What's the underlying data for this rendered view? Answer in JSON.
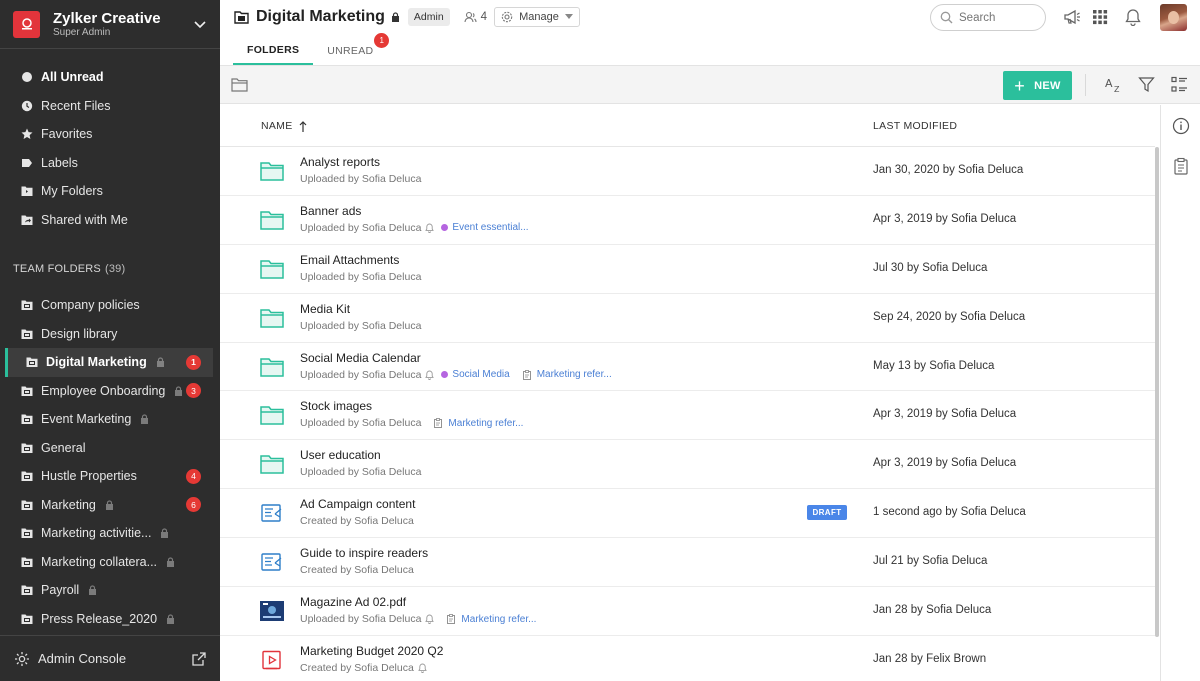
{
  "org": {
    "name": "Zylker Creative",
    "role": "Super Admin"
  },
  "nav": [
    {
      "label": "All Unread",
      "icon": "circle-dot-icon",
      "bold": true
    },
    {
      "label": "Recent Files",
      "icon": "clock-icon"
    },
    {
      "label": "Favorites",
      "icon": "star-icon"
    },
    {
      "label": "Labels",
      "icon": "label-icon"
    },
    {
      "label": "My Folders",
      "icon": "folder-icon"
    },
    {
      "label": "Shared with Me",
      "icon": "shared-folder-icon"
    }
  ],
  "team_folders": {
    "title": "TEAM FOLDERS",
    "count": "(39)"
  },
  "team": [
    {
      "label": "Company policies"
    },
    {
      "label": "Design library"
    },
    {
      "label": "Digital Marketing",
      "lock": true,
      "badge": "1",
      "active": true
    },
    {
      "label": "Employee Onboarding",
      "lock": true,
      "badge": "3"
    },
    {
      "label": "Event Marketing",
      "lock": true
    },
    {
      "label": "General"
    },
    {
      "label": "Hustle Properties",
      "badge": "4"
    },
    {
      "label": "Marketing",
      "lock": true,
      "badge": "6"
    },
    {
      "label": "Marketing activitie...",
      "lock": true
    },
    {
      "label": "Marketing collatera...",
      "lock": true
    },
    {
      "label": "Payroll",
      "lock": true
    },
    {
      "label": "Press Release_2020",
      "lock": true
    }
  ],
  "admin_console": "Admin Console",
  "header": {
    "title": "Digital Marketing",
    "role_badge": "Admin",
    "members": "4",
    "manage": "Manage",
    "search_placeholder": "Search",
    "tabs": [
      {
        "label": "FOLDERS",
        "active": true
      },
      {
        "label": "UNREAD",
        "badge": "1"
      }
    ]
  },
  "toolbar": {
    "new_label": "NEW"
  },
  "columns": {
    "name": "NAME",
    "modified": "LAST MODIFIED"
  },
  "rows": [
    {
      "name": "Analyst reports",
      "sub": "Uploaded by Sofia Deluca",
      "modified": "Jan 30, 2020 by Sofia Deluca",
      "type": "folder"
    },
    {
      "name": "Banner ads",
      "sub": "Uploaded by Sofia Deluca",
      "modified": "Apr 3, 2019 by Sofia Deluca",
      "type": "folder",
      "bell": true,
      "tags": [
        {
          "label": "Event essential...",
          "kind": "dot",
          "color": "#b565e0"
        }
      ]
    },
    {
      "name": "Email Attachments",
      "sub": "Uploaded by Sofia Deluca",
      "modified": "Jul 30 by Sofia Deluca",
      "type": "folder"
    },
    {
      "name": "Media Kit",
      "sub": "Uploaded by Sofia Deluca",
      "modified": "Sep 24, 2020 by Sofia Deluca",
      "type": "folder"
    },
    {
      "name": "Social Media Calendar",
      "sub": "Uploaded by Sofia Deluca",
      "modified": "May 13 by Sofia Deluca",
      "type": "folder",
      "bell": true,
      "tags": [
        {
          "label": "Social Media",
          "kind": "dot",
          "color": "#b565e0"
        },
        {
          "label": "Marketing refer...",
          "kind": "clip"
        }
      ]
    },
    {
      "name": "Stock images",
      "sub": "Uploaded by Sofia Deluca",
      "modified": "Apr 3, 2019 by Sofia Deluca",
      "type": "folder",
      "tags": [
        {
          "label": "Marketing refer...",
          "kind": "clip"
        }
      ]
    },
    {
      "name": "User education",
      "sub": "Uploaded by Sofia Deluca",
      "modified": "Apr 3, 2019 by Sofia Deluca",
      "type": "folder"
    },
    {
      "name": "Ad Campaign content",
      "sub": "Created by Sofia Deluca",
      "modified": "1 second ago by Sofia Deluca",
      "type": "writer",
      "draft": "DRAFT"
    },
    {
      "name": "Guide to inspire readers",
      "sub": "Created by Sofia Deluca",
      "modified": "Jul 21 by Sofia Deluca",
      "type": "writer"
    },
    {
      "name": "Magazine Ad 02.pdf",
      "sub": "Uploaded by Sofia Deluca",
      "modified": "Jan 28 by Sofia Deluca",
      "type": "image",
      "bell": true,
      "tags": [
        {
          "label": "Marketing refer...",
          "kind": "clip"
        }
      ]
    },
    {
      "name": "Marketing Budget 2020 Q2",
      "sub": "Created by Sofia Deluca",
      "modified": "Jan 28 by Felix Brown",
      "type": "show",
      "bell": true
    }
  ],
  "colors": {
    "accent": "#2bbf9c",
    "badge": "#e53935",
    "draft": "#4a86e8",
    "brand": "#e2343b",
    "sidebar": "#2d2d2d"
  }
}
